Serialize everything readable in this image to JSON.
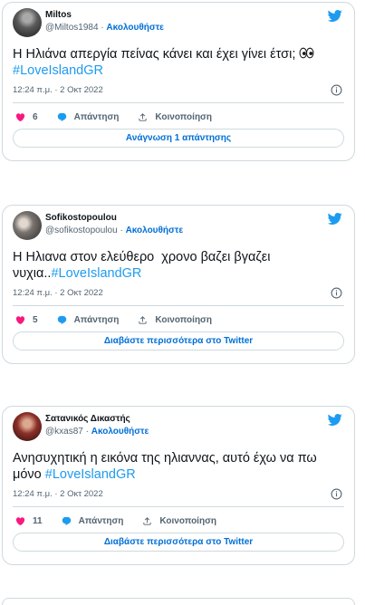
{
  "colors": {
    "accent": "#1d9bf0",
    "link": "#006fd6",
    "like": "#f91880",
    "text": "#0f1419",
    "muted": "#536471",
    "border": "#cfd9de"
  },
  "icons": {
    "logo": "twitter-bird",
    "info": "info-circle",
    "like": "heart",
    "reply": "speech-bubble",
    "share": "share-upload",
    "emoji": "eyes-emoji"
  },
  "ui": {
    "dot": "·",
    "follow_label": "Ακολουθήστε",
    "reply_label": "Απάντηση",
    "share_label": "Κοινοποίηση"
  },
  "tweets": [
    {
      "name": "Miltos",
      "handle": "@Miltos1984",
      "text": "Η Ηλιάνα απεργία πείνας κάνει και έχει γίνει έτσι;",
      "emoji_icon": "eyes-emoji",
      "hashtag": "#LoveIslandGR",
      "timestamp": "12:24 π.μ. · 2 Οκτ 2022",
      "likes": "6",
      "cta_label": "Ανάγνωση 1 απάντησης"
    },
    {
      "name": "Sofikostopoulou",
      "handle": "@sofikostopoulou",
      "text": "Η Ηλιανα στον ελεύθερο  χρονο βαζει βγαζει νυχια..",
      "hashtag": "#LoveIslandGR",
      "timestamp": "12:24 π.μ. · 2 Οκτ 2022",
      "likes": "5",
      "cta_label": "Διαβάστε περισσότερα στο Twitter"
    },
    {
      "name": "Σατανικός Δικαστής",
      "handle": "@kxas87",
      "text": "Ανησυχητική η εικόνα της ηλιαννας, αυτό έχω να πω\nμόνο",
      "hashtag": "#LoveIslandGR",
      "timestamp": "12:24 π.μ. · 2 Οκτ 2022",
      "likes": "11",
      "cta_label": "Διαβάστε περισσότερα στο Twitter"
    }
  ]
}
